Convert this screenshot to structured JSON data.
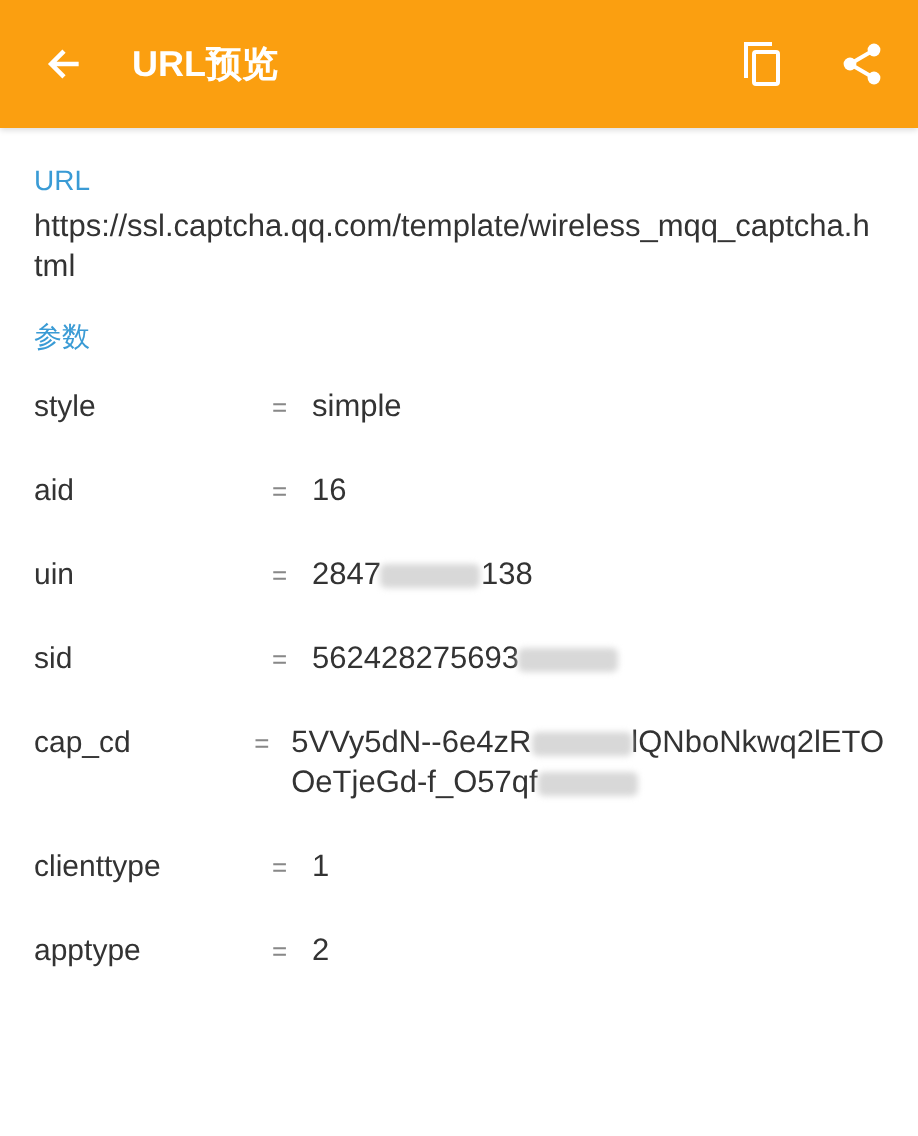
{
  "app_bar": {
    "title": "URL预览"
  },
  "url_section": {
    "label": "URL",
    "value": "https://ssl.captcha.qq.com/template/wireless_mqq_captcha.html"
  },
  "params_section": {
    "label": "参数",
    "separator": "=",
    "params": [
      {
        "name": "style",
        "lines": [
          [
            {
              "kind": "text",
              "text": "simple"
            }
          ]
        ]
      },
      {
        "name": "aid",
        "lines": [
          [
            {
              "kind": "text",
              "text": "16"
            }
          ]
        ]
      },
      {
        "name": "uin",
        "lines": [
          [
            {
              "kind": "text",
              "text": "2847"
            },
            {
              "kind": "blur"
            },
            {
              "kind": "text",
              "text": "138"
            }
          ]
        ]
      },
      {
        "name": "sid",
        "lines": [
          [
            {
              "kind": "text",
              "text": "562428275693"
            },
            {
              "kind": "blur"
            }
          ]
        ]
      },
      {
        "name": "cap_cd",
        "lines": [
          [
            {
              "kind": "text",
              "text": "5VVy5dN--6e4zR"
            },
            {
              "kind": "blur"
            },
            {
              "kind": "text",
              "text": "lQNboNkwq2lETO"
            }
          ],
          [
            {
              "kind": "text",
              "text": "OeTjeGd-f_O57qf"
            },
            {
              "kind": "blur"
            }
          ]
        ]
      },
      {
        "name": "clienttype",
        "lines": [
          [
            {
              "kind": "text",
              "text": "1"
            }
          ]
        ]
      },
      {
        "name": "apptype",
        "lines": [
          [
            {
              "kind": "text",
              "text": "2"
            }
          ]
        ]
      }
    ]
  }
}
